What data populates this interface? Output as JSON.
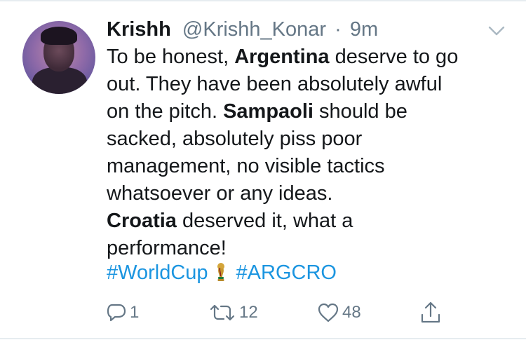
{
  "tweet": {
    "author_name": "Krishh",
    "author_handle": "@Krishh_Konar",
    "separator": "·",
    "time": "9m",
    "text": {
      "l1_pre": "To be honest, ",
      "l1_bold": "Argentina",
      "l1_post": " deserve to go",
      "l2": "out. They have been absolutely awful",
      "l3_pre": "on the pitch. ",
      "l3_bold": "Sampaoli",
      "l3_post": " should be",
      "l4": "sacked, absolutely piss poor",
      "l5": "management, no visible tactics",
      "l6": "whatsoever or any ideas.",
      "l7_bold": "Croatia",
      "l7_post": " deserved it, what a",
      "l8": "performance!"
    },
    "hashtags": [
      "#WorldCup",
      "#ARGCRO"
    ],
    "hashtag_emoji_icon": "world-cup-trophy-icon"
  },
  "actions": {
    "reply_count": "1",
    "retweet_count": "12",
    "like_count": "48"
  },
  "colors": {
    "text": "#14171a",
    "secondary": "#657786",
    "link": "#1b95e0",
    "divider": "#e6ecf0"
  }
}
